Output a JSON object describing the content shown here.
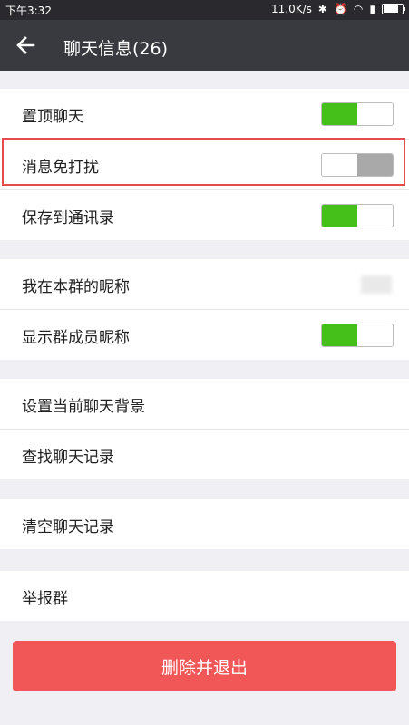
{
  "status_bar": {
    "time": "下午3:32",
    "network_speed": "11.0K/s",
    "battery_level": 0.8,
    "icons": [
      "bluetooth-icon",
      "alarm-icon",
      "wifi-icon",
      "signal-icon",
      "battery-icon"
    ]
  },
  "header": {
    "title": "聊天信息(26)",
    "back_icon": "arrow-left-icon"
  },
  "groups": [
    {
      "rows": [
        {
          "label": "置顶聊天",
          "toggle": "on"
        },
        {
          "label": "消息免打扰",
          "toggle": "off",
          "highlighted": true
        },
        {
          "label": "保存到通讯录",
          "toggle": "on"
        }
      ]
    },
    {
      "rows": [
        {
          "label": "我在本群的昵称"
        },
        {
          "label": "显示群成员昵称",
          "toggle": "on"
        }
      ]
    },
    {
      "rows": [
        {
          "label": "设置当前聊天背景"
        },
        {
          "label": "查找聊天记录"
        }
      ]
    },
    {
      "rows": [
        {
          "label": "清空聊天记录"
        }
      ]
    },
    {
      "rows": [
        {
          "label": "举报群"
        }
      ]
    }
  ],
  "actions": {
    "delete_exit_label": "删除并退出"
  },
  "colors": {
    "toggle_on": "#45c01a",
    "toggle_off": "#a9a9a9",
    "danger": "#f05756",
    "highlight": "#e74c4c",
    "header_bg": "#393a3f"
  }
}
